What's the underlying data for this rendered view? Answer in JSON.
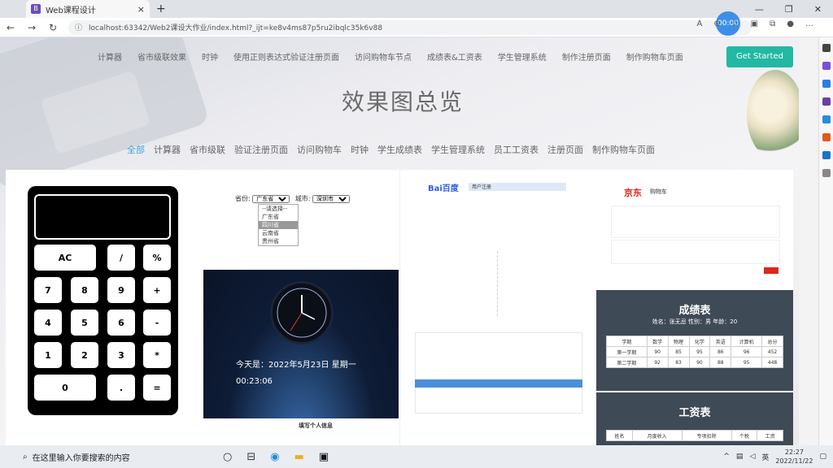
{
  "browser": {
    "tab_title": "Web课程设计",
    "url": "localhost:63342/Web2课设大作业/index.html?_ijt=ke8v4ms87p5ru2ibqlc35k6v88",
    "timer": "00:00"
  },
  "site": {
    "topnav": [
      "计算器",
      "省市级联效果",
      "时钟",
      "使用正则表达式验证注册页面",
      "访问购物车节点",
      "成绩表&工资表",
      "学生管理系统",
      "制作注册页面",
      "制作购物车页面"
    ],
    "get_started": "Get Started",
    "title": "效果图总览",
    "filters": [
      "全部",
      "计算器",
      "省市级联",
      "验证注册页面",
      "访问购物车",
      "时钟",
      "学生成绩表",
      "学生管理系统",
      "员工工资表",
      "注册页面",
      "制作购物车页面"
    ]
  },
  "calculator": {
    "keys": [
      "AC",
      "/",
      "%",
      "7",
      "8",
      "9",
      "+",
      "4",
      "5",
      "6",
      "-",
      "1",
      "2",
      "3",
      "*",
      "0",
      ".",
      "="
    ]
  },
  "cityform": {
    "province_label": "省份:",
    "province_value": "广东省",
    "city_label": "城市:",
    "city_value": "深圳市",
    "options": [
      "--请选择--",
      "广东省",
      "四川省",
      "云南省",
      "贵州省"
    ]
  },
  "clock": {
    "date_text": "今天是：2022年5月23日 星期一",
    "time_text": "00:23:06"
  },
  "personal": {
    "title": "填写个人信息"
  },
  "register": {
    "brand": "Bai百度",
    "subtitle": "用户注册"
  },
  "jd": {
    "brand": "京东",
    "subtitle": "购物车"
  },
  "scores": {
    "title": "成绩表",
    "info": "姓名：张无忌   性别：男   年龄：20",
    "headers": [
      "学期",
      "数学",
      "物理",
      "化学",
      "英语",
      "计算机",
      "总分"
    ],
    "rows": [
      [
        "第一学期",
        "90",
        "85",
        "95",
        "86",
        "96",
        "452"
      ],
      [
        "第二学期",
        "92",
        "83",
        "90",
        "88",
        "95",
        "448"
      ]
    ]
  },
  "salary": {
    "title": "工资表",
    "headers": [
      "姓名",
      "月度收入",
      "专项扣除",
      "个税",
      "工资"
    ]
  },
  "taskbar": {
    "search_placeholder": "在这里输入你要搜索的内容",
    "ime": "英",
    "time": "22:27",
    "date": "2022/11/22"
  }
}
